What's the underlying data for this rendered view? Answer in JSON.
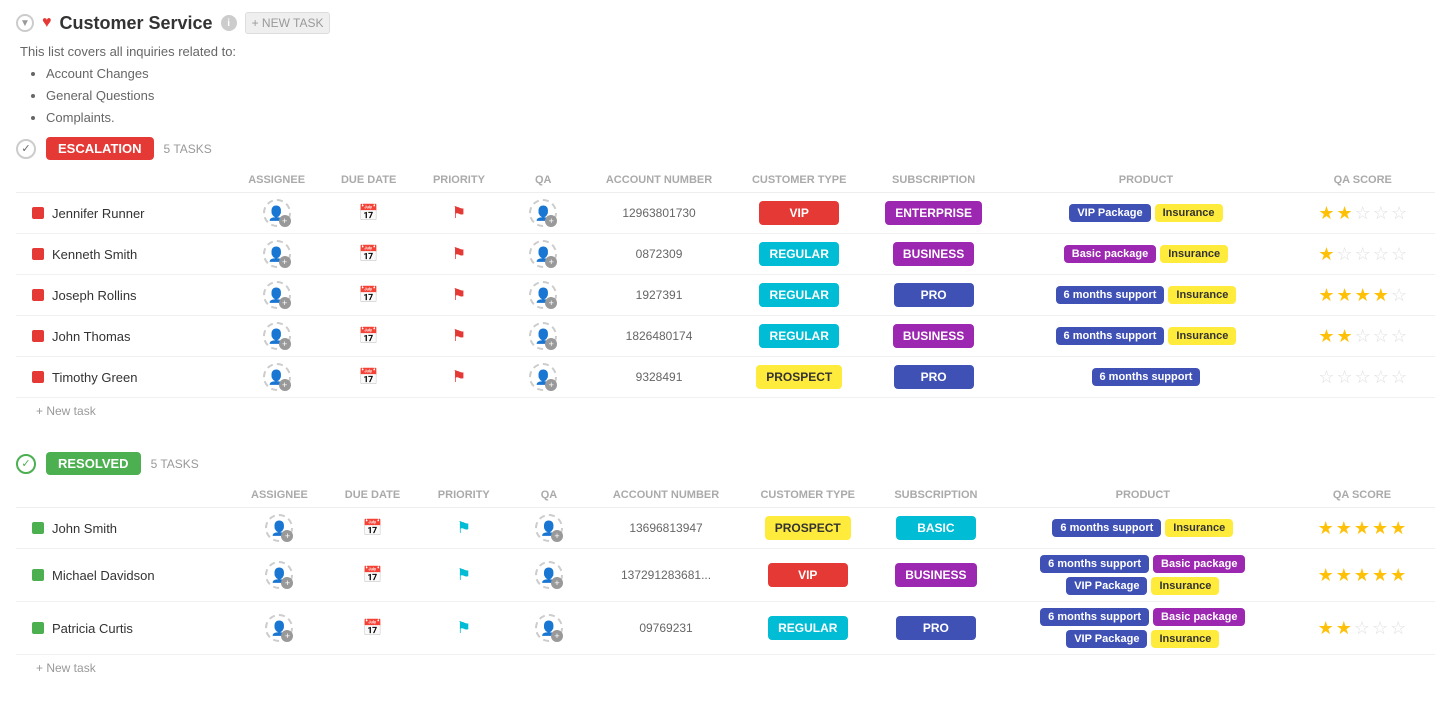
{
  "header": {
    "title": "Customer Service",
    "new_task_label": "+ NEW TASK"
  },
  "description": {
    "intro": "This list covers all inquiries related to:",
    "bullets": [
      "Account Changes",
      "General Questions",
      "Complaints."
    ]
  },
  "groups": [
    {
      "id": "escalation",
      "badge": "ESCALATION",
      "badge_type": "escalation",
      "task_count": "5 TASKS",
      "columns": [
        "ASSIGNEE",
        "DUE DATE",
        "PRIORITY",
        "QA",
        "ACCOUNT NUMBER",
        "CUSTOMER TYPE",
        "SUBSCRIPTION",
        "PRODUCT",
        "QA SCORE"
      ],
      "tasks": [
        {
          "name": "Jennifer Runner",
          "account": "12963801730",
          "customer_type": "VIP",
          "customer_type_class": "ctype-vip",
          "subscription": "ENTERPRISE",
          "subscription_class": "sub-enterprise",
          "products": [
            {
              "label": "VIP Package",
              "class": "tag-vip-pkg"
            },
            {
              "label": "Insurance",
              "class": "tag-insurance"
            }
          ],
          "stars": [
            1,
            1,
            0,
            0,
            0
          ],
          "flag_class": "flag-red"
        },
        {
          "name": "Kenneth Smith",
          "account": "0872309",
          "customer_type": "REGULAR",
          "customer_type_class": "ctype-regular",
          "subscription": "BUSINESS",
          "subscription_class": "sub-business",
          "products": [
            {
              "label": "Basic package",
              "class": "tag-basic-pkg"
            },
            {
              "label": "Insurance",
              "class": "tag-insurance"
            }
          ],
          "stars": [
            1,
            0,
            0,
            0,
            0
          ],
          "flag_class": "flag-red"
        },
        {
          "name": "Joseph Rollins",
          "account": "1927391",
          "customer_type": "REGULAR",
          "customer_type_class": "ctype-regular",
          "subscription": "PRO",
          "subscription_class": "sub-pro",
          "products": [
            {
              "label": "6 months support",
              "class": "tag-6months"
            },
            {
              "label": "Insurance",
              "class": "tag-insurance"
            }
          ],
          "stars": [
            1,
            1,
            1,
            1,
            0
          ],
          "flag_class": "flag-red"
        },
        {
          "name": "John Thomas",
          "account": "1826480174",
          "customer_type": "REGULAR",
          "customer_type_class": "ctype-regular",
          "subscription": "BUSINESS",
          "subscription_class": "sub-business",
          "products": [
            {
              "label": "6 months support",
              "class": "tag-6months"
            },
            {
              "label": "Insurance",
              "class": "tag-insurance"
            }
          ],
          "stars": [
            1,
            1,
            0,
            0,
            0
          ],
          "flag_class": "flag-red"
        },
        {
          "name": "Timothy Green",
          "account": "9328491",
          "customer_type": "PROSPECT",
          "customer_type_class": "ctype-prospect",
          "subscription": "PRO",
          "subscription_class": "sub-pro",
          "products": [
            {
              "label": "6 months support",
              "class": "tag-6months"
            }
          ],
          "stars": [
            0,
            0,
            0,
            0,
            0
          ],
          "flag_class": "flag-red"
        }
      ],
      "new_task_label": "+ New task"
    },
    {
      "id": "resolved",
      "badge": "RESOLVED",
      "badge_type": "resolved",
      "task_count": "5 TASKS",
      "columns": [
        "ASSIGNEE",
        "DUE DATE",
        "PRIORITY",
        "QA",
        "ACCOUNT NUMBER",
        "CUSTOMER TYPE",
        "SUBSCRIPTION",
        "PRODUCT",
        "QA SCORE"
      ],
      "tasks": [
        {
          "name": "John Smith",
          "account": "13696813947",
          "customer_type": "PROSPECT",
          "customer_type_class": "ctype-prospect",
          "subscription": "BASIC",
          "subscription_class": "sub-basic",
          "products": [
            {
              "label": "6 months support",
              "class": "tag-6months"
            },
            {
              "label": "Insurance",
              "class": "tag-insurance"
            }
          ],
          "stars": [
            1,
            1,
            1,
            1,
            1
          ],
          "flag_class": "flag-cyan"
        },
        {
          "name": "Michael Davidson",
          "account": "137291283681...",
          "customer_type": "VIP",
          "customer_type_class": "ctype-vip",
          "subscription": "BUSINESS",
          "subscription_class": "sub-business",
          "products": [
            {
              "label": "6 months support",
              "class": "tag-6months"
            },
            {
              "label": "Basic package",
              "class": "tag-basic-pkg"
            },
            {
              "label": "VIP Package",
              "class": "tag-vip-pkg"
            },
            {
              "label": "Insurance",
              "class": "tag-insurance"
            }
          ],
          "stars": [
            1,
            1,
            1,
            1,
            1
          ],
          "flag_class": "flag-cyan"
        },
        {
          "name": "Patricia Curtis",
          "account": "09769231",
          "customer_type": "REGULAR",
          "customer_type_class": "ctype-regular",
          "subscription": "PRO",
          "subscription_class": "sub-pro",
          "products": [
            {
              "label": "6 months support",
              "class": "tag-6months"
            },
            {
              "label": "Basic package",
              "class": "tag-basic-pkg"
            },
            {
              "label": "VIP Package",
              "class": "tag-vip-pkg"
            },
            {
              "label": "Insurance",
              "class": "tag-insurance"
            }
          ],
          "stars": [
            1,
            1,
            0,
            0,
            0
          ],
          "flag_class": "flag-cyan"
        }
      ],
      "new_task_label": "+ New task"
    }
  ]
}
